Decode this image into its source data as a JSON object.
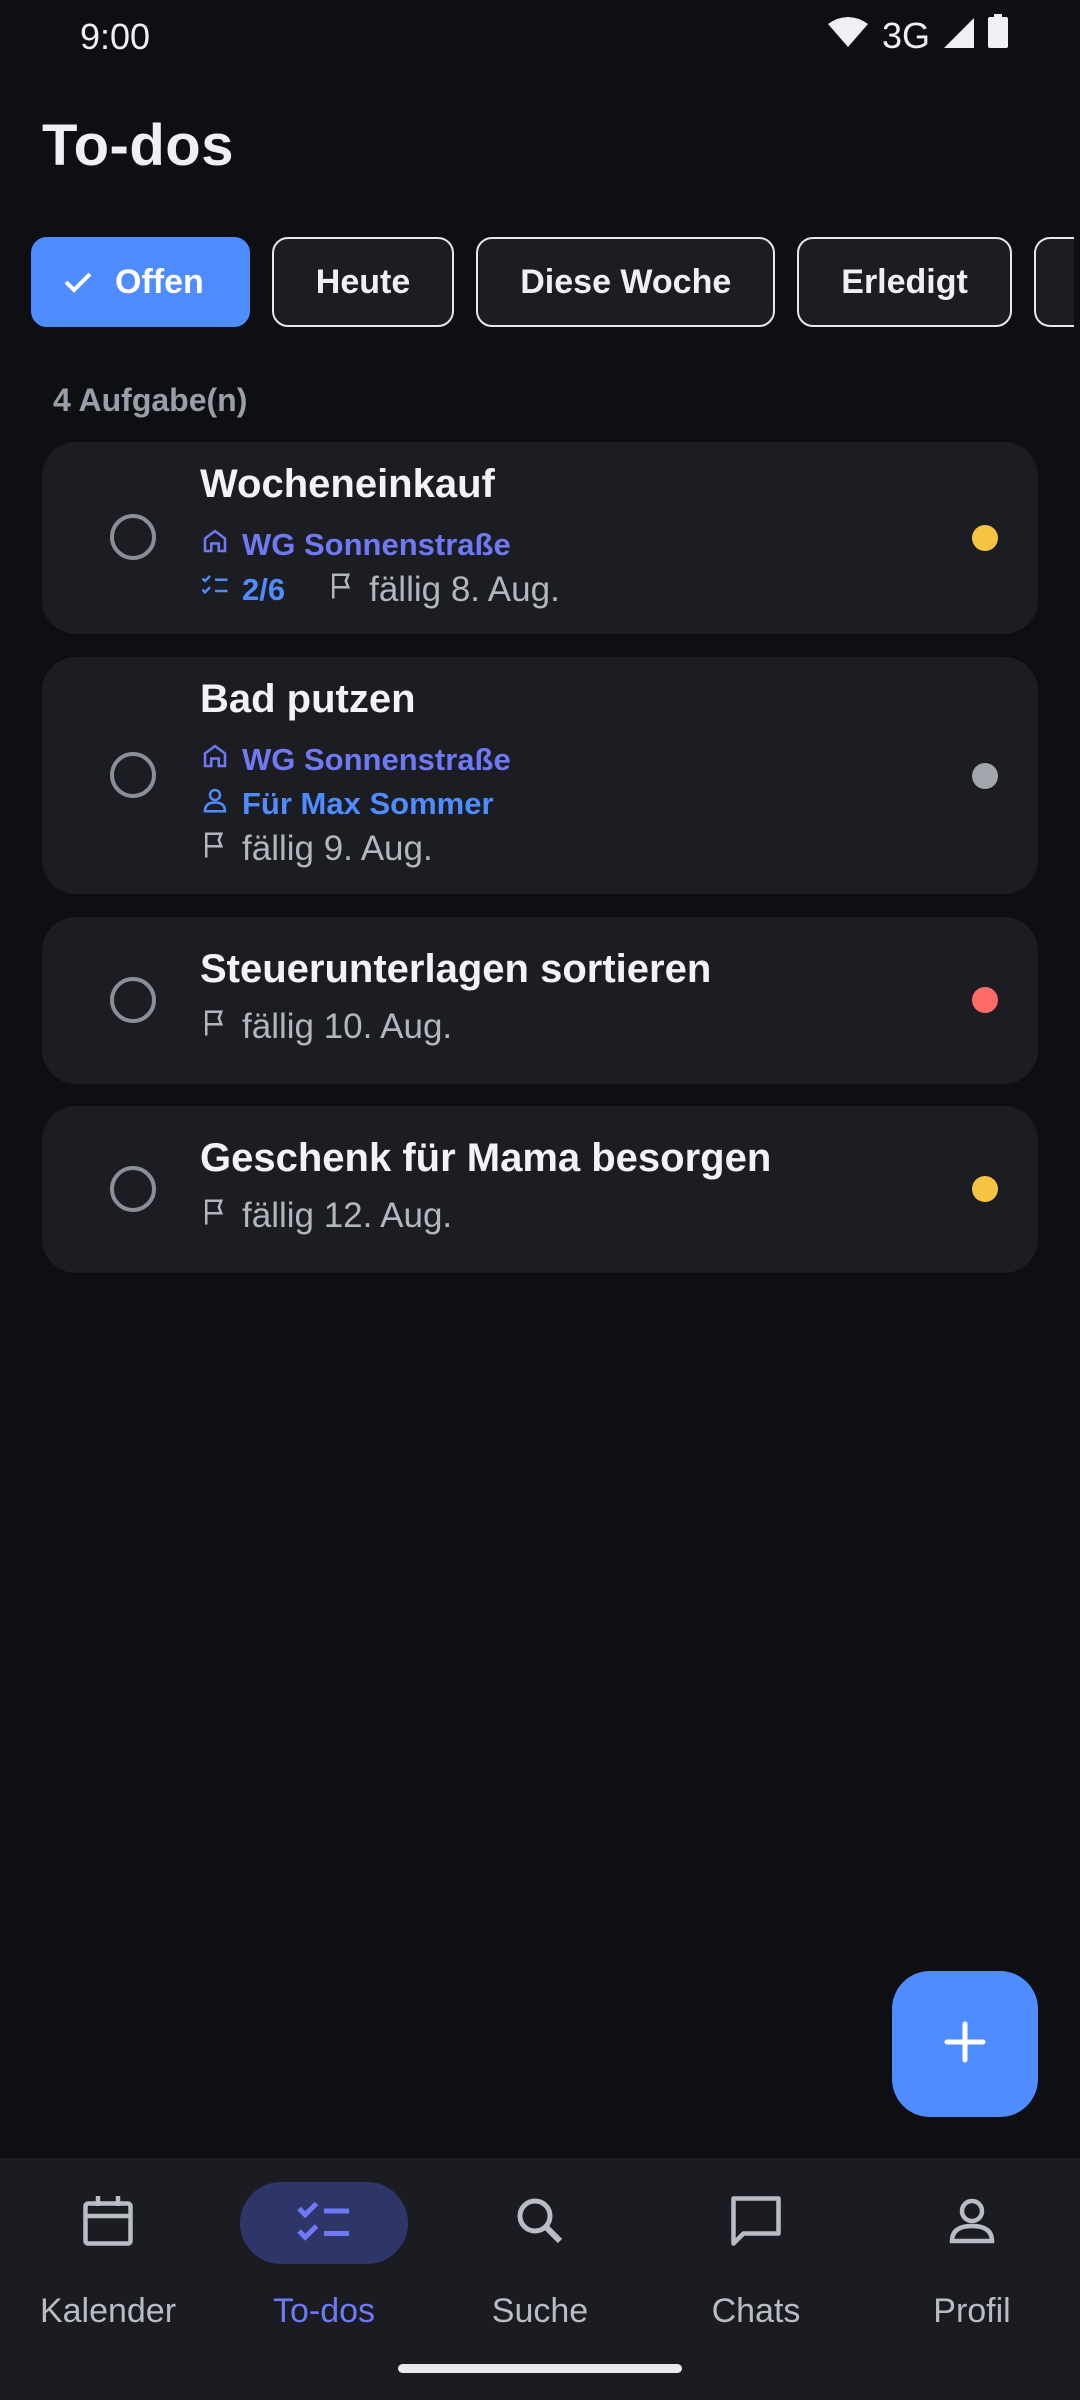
{
  "status_bar": {
    "time": "9:00",
    "network": "3G"
  },
  "header": {
    "title": "To-dos"
  },
  "filters": [
    {
      "label": "Offen",
      "active": true
    },
    {
      "label": "Heute",
      "active": false
    },
    {
      "label": "Diese Woche",
      "active": false
    },
    {
      "label": "Erledigt",
      "active": false
    }
  ],
  "list": {
    "count_label": "4 Aufgabe(n)",
    "tasks": [
      {
        "title": "Wocheneinkauf",
        "group": "WG Sonnenstraße",
        "subtasks": "2/6",
        "due": "fällig 8. Aug.",
        "priority_color": "#f5c542"
      },
      {
        "title": "Bad putzen",
        "group": "WG Sonnenstraße",
        "assignee": "Für Max Sommer",
        "due": "fällig 9. Aug.",
        "priority_color": "#a3a6ad"
      },
      {
        "title": "Steuerunterlagen sortieren",
        "due": "fällig 10. Aug.",
        "priority_color": "#ff6b6b"
      },
      {
        "title": "Geschenk für Mama besorgen",
        "due": "fällig 12. Aug.",
        "priority_color": "#f5c542"
      }
    ]
  },
  "bottom_nav": [
    {
      "label": "Kalender",
      "icon": "calendar-icon",
      "active": false
    },
    {
      "label": "To-dos",
      "icon": "checklist-icon",
      "active": true
    },
    {
      "label": "Suche",
      "icon": "search-icon",
      "active": false
    },
    {
      "label": "Chats",
      "icon": "chat-icon",
      "active": false
    },
    {
      "label": "Profil",
      "icon": "profile-icon",
      "active": false
    }
  ],
  "colors": {
    "accent": "#4f8cff",
    "group": "#6f79f5",
    "background": "#0e0f13",
    "card": "#1c1d22"
  }
}
